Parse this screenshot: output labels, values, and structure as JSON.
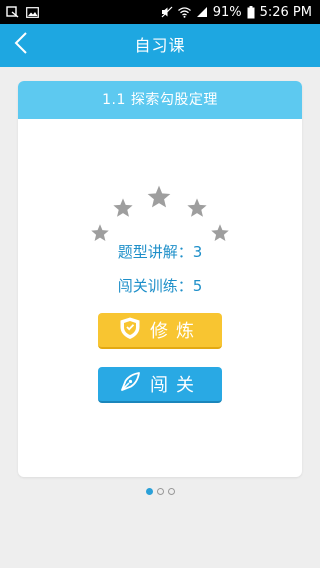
{
  "status_bar": {
    "battery_percent": "91%",
    "time": "5:26 PM"
  },
  "header": {
    "title": "自习课"
  },
  "lesson": {
    "title": "1.1 探索勾股定理",
    "stars_total": 5,
    "stars_filled": 0,
    "stat_explain": "题型讲解：3",
    "stat_training": "闯关训练：5"
  },
  "actions": {
    "practice_label": "修炼",
    "challenge_label": "闯关"
  },
  "pager": {
    "pages": 3,
    "current": 1
  },
  "colors": {
    "primary": "#1ea7e1",
    "card_header": "#5dc9f0",
    "practice_button": "#f8c531",
    "challenge_button": "#29a9e4",
    "stat_text": "#1e8fc9",
    "star_empty": "#9e9e9e"
  }
}
